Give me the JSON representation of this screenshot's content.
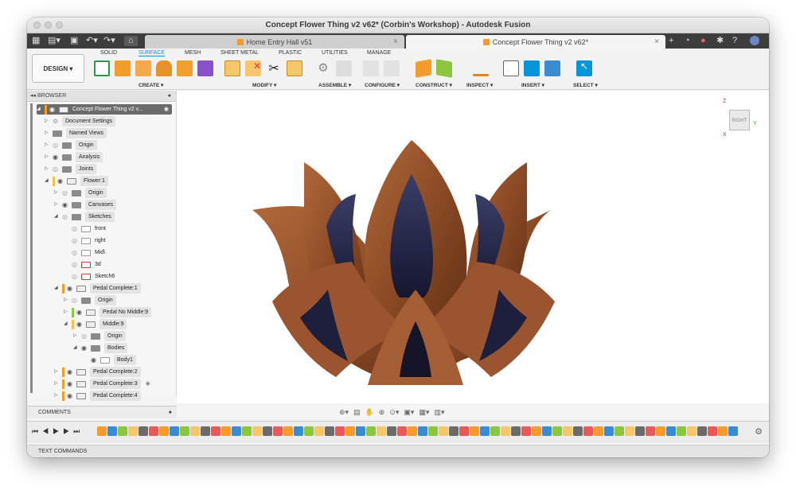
{
  "window": {
    "title": "Concept Flower Thing v2 v62* (Corbin's Workshop) - Autodesk Fusion"
  },
  "tabs": [
    {
      "label": "Home Entry Hall v51",
      "active": false
    },
    {
      "label": "Concept Flower Thing v2 v62*",
      "active": true
    }
  ],
  "workspace": {
    "label": "DESIGN ▾"
  },
  "ribbon_tabs": [
    "SOLID",
    "SURFACE",
    "MESH",
    "SHEET METAL",
    "PLASTIC",
    "UTILITIES",
    "MANAGE"
  ],
  "ribbon_groups": [
    "CREATE ▾",
    "MODIFY ▾",
    "ASSEMBLE ▾",
    "CONFIGURE ▾",
    "CONSTRUCT ▾",
    "INSPECT ▾",
    "INSERT ▾",
    "SELECT ▾"
  ],
  "browser": {
    "title": "BROWSER",
    "root": "Concept Flower Thing v2 v...",
    "items": [
      "Document Settings",
      "Named Views",
      "Origin",
      "Analysis",
      "Joints",
      "Flower:1",
      "Origin",
      "Canvases",
      "Sketches",
      "front",
      "right",
      "Mid\\",
      "3d",
      "Sketch6",
      "Pedal Complete:1",
      "Origin",
      "Pedal No Middle:9",
      "Middle:9",
      "Origin",
      "Bodies",
      "Body1",
      "Pedal Complete:2",
      "Pedal Complete:3",
      "Pedal Complete:4"
    ]
  },
  "viewcube": {
    "face": "RIGHT",
    "axis_z": "Z",
    "axis_y": "Y",
    "axis_x": "X"
  },
  "panels": {
    "comments": "COMMENTS",
    "text_commands": "TEXT COMMANDS"
  },
  "colors": {
    "accent": "#0696d7",
    "wood": "#8b4a25",
    "tab_bar": "#3d3d3d"
  }
}
